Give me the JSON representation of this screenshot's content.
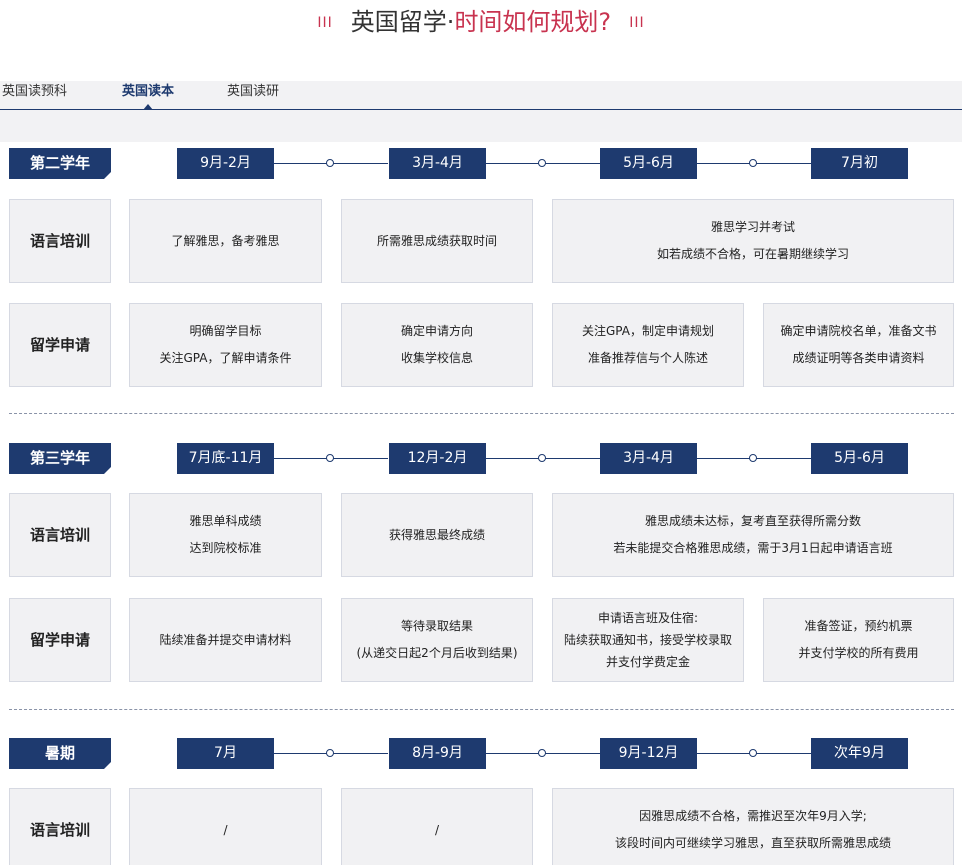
{
  "page": {
    "title_prefix": "英国留学·",
    "title_accent": "时间如何规划?",
    "title_bars": "III"
  },
  "tabs": [
    {
      "label": "英国读预科",
      "active": false
    },
    {
      "label": "英国读本",
      "active": true
    },
    {
      "label": "英国读研",
      "active": false
    }
  ],
  "sections": [
    {
      "year": "第二学年",
      "periods": [
        "9月-2月",
        "3月-4月",
        "5月-6月",
        "7月初"
      ],
      "rows": [
        {
          "label": "语言培训",
          "cells": [
            [
              "了解雅思，备考雅思"
            ],
            [
              "所需雅思成绩获取时间"
            ],
            [
              "雅思学习并考试",
              "如若成绩不合格，可在暑期继续学习"
            ]
          ]
        },
        {
          "label": "留学申请",
          "cells": [
            [
              "明确留学目标",
              "关注GPA，了解申请条件"
            ],
            [
              "确定申请方向",
              "收集学校信息"
            ],
            [
              "关注GPA，制定申请规划",
              "准备推荐信与个人陈述"
            ],
            [
              "确定申请院校名单，准备文书",
              "成绩证明等各类申请资料"
            ]
          ]
        }
      ]
    },
    {
      "year": "第三学年",
      "periods": [
        "7月底-11月",
        "12月-2月",
        "3月-4月",
        "5月-6月"
      ],
      "rows": [
        {
          "label": "语言培训",
          "cells": [
            [
              "雅思单科成绩",
              "达到院校标准"
            ],
            [
              "获得雅思最终成绩"
            ],
            [
              "雅思成绩未达标，复考直至获得所需分数",
              "若未能提交合格雅思成绩，需于3月1日起申请语言班"
            ]
          ]
        },
        {
          "label": "留学申请",
          "cells": [
            [
              "陆续准备并提交申请材料"
            ],
            [
              "等待录取结果",
              "(从递交日起2个月后收到结果)"
            ],
            [
              "申请语言班及住宿:",
              "陆续获取通知书，接受学校录取",
              "并支付学费定金"
            ],
            [
              "准备签证，预约机票",
              "并支付学校的所有费用"
            ]
          ]
        }
      ]
    },
    {
      "year": "暑期",
      "periods": [
        "7月",
        "8月-9月",
        "9月-12月",
        "次年9月"
      ],
      "rows": [
        {
          "label": "语言培训",
          "cells": [
            [
              "/"
            ],
            [
              "/"
            ],
            [
              "因雅思成绩不合格，需推迟至次年9月入学;",
              "该段时间内可继续学习雅思，直至获取所需雅思成绩"
            ]
          ]
        }
      ]
    }
  ]
}
